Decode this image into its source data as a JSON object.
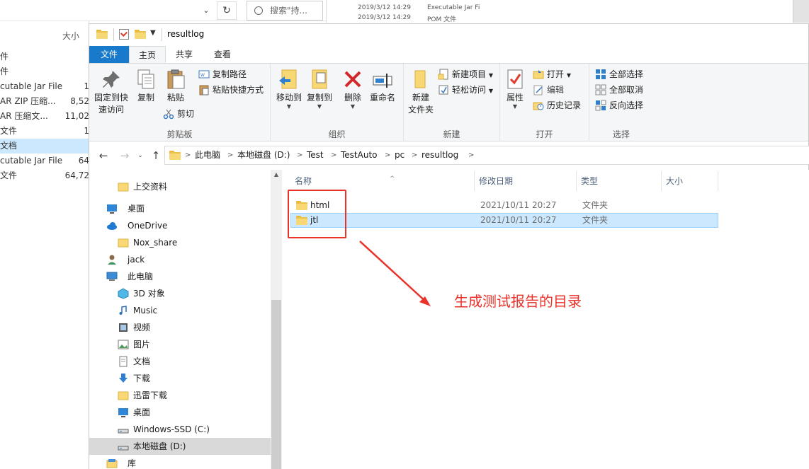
{
  "background": {
    "search_placeholder": "搜索\"持...",
    "size_header": "大小",
    "rows": [
      {
        "name": "件",
        "size": ""
      },
      {
        "name": "件",
        "size": ""
      },
      {
        "name": "cutable Jar File",
        "size": "1"
      },
      {
        "name": "AR ZIP 压缩...",
        "size": "8,52"
      },
      {
        "name": "AR 压缩文...",
        "size": "11,02"
      },
      {
        "name": "文件",
        "size": "1"
      },
      {
        "name": "文档",
        "size": ""
      },
      {
        "name": "cutable Jar File",
        "size": "64"
      },
      {
        "name": "文件",
        "size": "64,72"
      }
    ],
    "mid_rows": [
      {
        "date": "2019/3/12 14:29",
        "type": "Executable Jar Fi"
      },
      {
        "date": "2019/3/12 14:29",
        "type": "POM 文件"
      }
    ]
  },
  "window": {
    "title": "resultlog"
  },
  "ribbon_tabs": [
    "文件",
    "主页",
    "共享",
    "查看"
  ],
  "ribbon": {
    "clipboard": {
      "label": "剪贴板",
      "pin": "固定到快\n速访问",
      "copy": "复制",
      "paste": "粘贴",
      "copy_path": "复制路径",
      "paste_shortcut": "粘贴快捷方式",
      "cut": "剪切"
    },
    "organize": {
      "label": "组织",
      "move_to": "移动到",
      "copy_to": "复制到",
      "delete": "删除",
      "rename": "重命名"
    },
    "new": {
      "label": "新建",
      "new_folder": "新建\n文件夹",
      "new_item": "新建项目",
      "easy_access": "轻松访问"
    },
    "open": {
      "label": "打开",
      "properties": "属性",
      "open": "打开",
      "edit": "编辑",
      "history": "历史记录"
    },
    "select": {
      "label": "选择",
      "select_all": "全部选择",
      "select_none": "全部取消",
      "invert": "反向选择"
    }
  },
  "breadcrumb": [
    "此电脑",
    "本地磁盘 (D:)",
    "Test",
    "TestAuto",
    "pc",
    "resultlog"
  ],
  "nav": [
    {
      "label": "上交资料",
      "icon": "folder-icon",
      "indent": 1
    },
    {
      "label": "桌面",
      "icon": "desktop-icon",
      "indent": 0
    },
    {
      "label": "OneDrive",
      "icon": "cloud-icon",
      "indent": 0
    },
    {
      "label": "Nox_share",
      "icon": "folder-icon",
      "indent": 1
    },
    {
      "label": "jack",
      "icon": "user-icon",
      "indent": 0
    },
    {
      "label": "此电脑",
      "icon": "computer-icon",
      "indent": 0
    },
    {
      "label": "3D 对象",
      "icon": "cube-icon",
      "indent": 1
    },
    {
      "label": "Music",
      "icon": "music-icon",
      "indent": 1
    },
    {
      "label": "视频",
      "icon": "video-icon",
      "indent": 1
    },
    {
      "label": "图片",
      "icon": "picture-icon",
      "indent": 1
    },
    {
      "label": "文档",
      "icon": "document-icon",
      "indent": 1
    },
    {
      "label": "下载",
      "icon": "download-icon",
      "indent": 1
    },
    {
      "label": "迅雷下载",
      "icon": "folder-icon",
      "indent": 1
    },
    {
      "label": "桌面",
      "icon": "desktop-icon",
      "indent": 1
    },
    {
      "label": "Windows-SSD (C:)",
      "icon": "drive-icon",
      "indent": 1
    },
    {
      "label": "本地磁盘 (D:)",
      "icon": "drive-icon",
      "indent": 1
    },
    {
      "label": "库",
      "icon": "library-icon",
      "indent": 0
    }
  ],
  "columns": {
    "name": "名称",
    "modified": "修改日期",
    "type": "类型",
    "size": "大小"
  },
  "files": [
    {
      "name": "html",
      "modified": "2021/10/11 20:27",
      "type": "文件夹"
    },
    {
      "name": "jtl",
      "modified": "2021/10/11 20:27",
      "type": "文件夹"
    }
  ],
  "annotation": "生成测试报告的目录",
  "colors": {
    "accent": "#1979ca",
    "selection": "#cce8ff",
    "annotation_red": "#e8322a",
    "folder": "#f8d775"
  }
}
